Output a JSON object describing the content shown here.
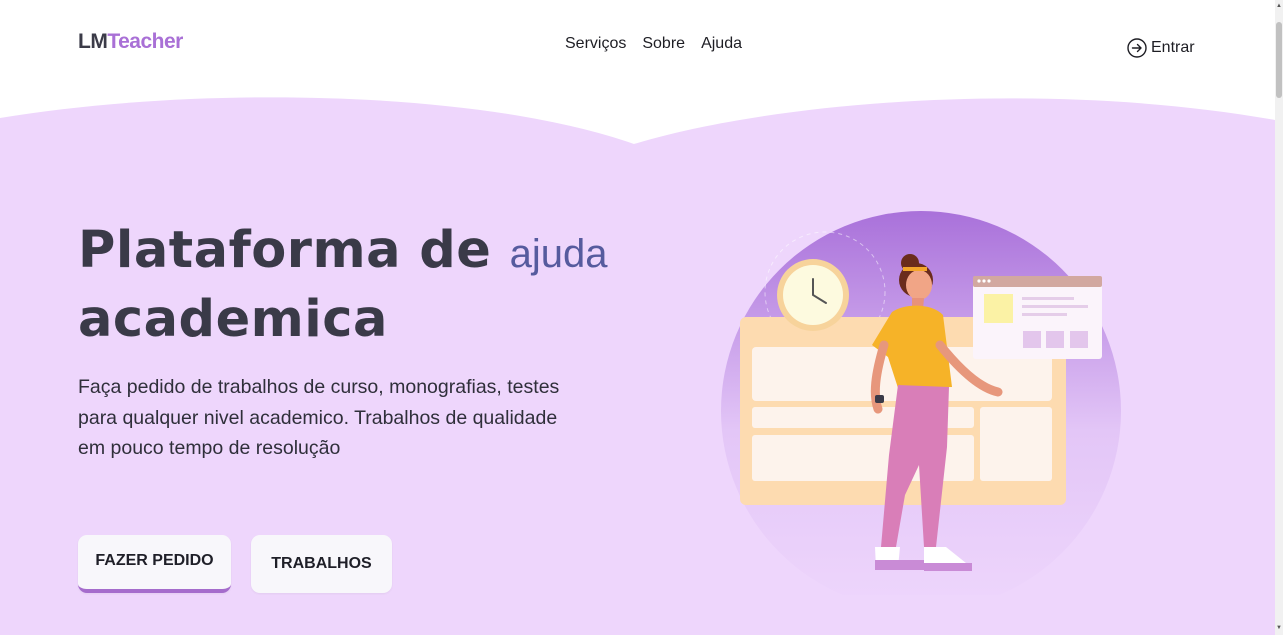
{
  "brand": {
    "part1": "LM",
    "part2": "Teacher"
  },
  "nav": {
    "items": [
      "Serviços",
      "Sobre",
      "Ajuda"
    ]
  },
  "login": {
    "label": "Entrar"
  },
  "hero": {
    "title_main": "Plataforma de",
    "title_accent": "ajuda",
    "title_line2": "academica",
    "description": "Faça pedido de trabalhos de curso, monografias, testes para qualquer nivel academico. Trabalhos de qualidade em pouco tempo de resolução"
  },
  "buttons": {
    "order": "FAZER PEDIDO",
    "works": "TRABALHOS"
  },
  "colors": {
    "hero_bg": "#eed6fc",
    "brand_accent": "#a970d6",
    "title_text": "#3a3a48",
    "title_accent": "#565b9e"
  },
  "icons": {
    "login": "arrow-right-circle-icon",
    "illustration": "student-with-clock-and-dashboard"
  }
}
